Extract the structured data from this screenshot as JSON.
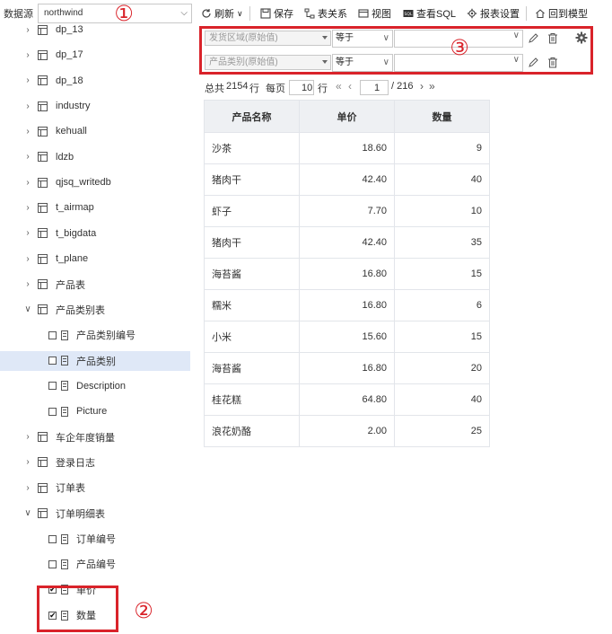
{
  "datasource": {
    "label": "数据源",
    "value": "northwind"
  },
  "tree": [
    {
      "level": 0,
      "kind": "table",
      "expanded": false,
      "label": "dp_13"
    },
    {
      "level": 0,
      "kind": "table",
      "expanded": false,
      "label": "dp_17"
    },
    {
      "level": 0,
      "kind": "table",
      "expanded": false,
      "label": "dp_18"
    },
    {
      "level": 0,
      "kind": "table",
      "expanded": false,
      "label": "industry"
    },
    {
      "level": 0,
      "kind": "table",
      "expanded": false,
      "label": "kehuall"
    },
    {
      "level": 0,
      "kind": "table",
      "expanded": false,
      "label": "ldzb"
    },
    {
      "level": 0,
      "kind": "table",
      "expanded": false,
      "label": "qjsq_writedb"
    },
    {
      "level": 0,
      "kind": "table",
      "expanded": false,
      "label": "t_airmap"
    },
    {
      "level": 0,
      "kind": "table",
      "expanded": false,
      "label": "t_bigdata"
    },
    {
      "level": 0,
      "kind": "table",
      "expanded": false,
      "label": "t_plane"
    },
    {
      "level": 0,
      "kind": "table",
      "expanded": false,
      "label": "产品表"
    },
    {
      "level": 0,
      "kind": "table",
      "expanded": true,
      "label": "产品类别表"
    },
    {
      "level": 1,
      "kind": "field",
      "checked": false,
      "label": "产品类别编号"
    },
    {
      "level": 1,
      "kind": "field",
      "checked": false,
      "label": "产品类别",
      "selected": true
    },
    {
      "level": 1,
      "kind": "field",
      "checked": false,
      "label": "Description"
    },
    {
      "level": 1,
      "kind": "field",
      "checked": false,
      "label": "Picture"
    },
    {
      "level": 0,
      "kind": "table",
      "expanded": false,
      "label": "车企年度销量"
    },
    {
      "level": 0,
      "kind": "table",
      "expanded": false,
      "label": "登录日志"
    },
    {
      "level": 0,
      "kind": "table",
      "expanded": false,
      "label": "订单表"
    },
    {
      "level": 0,
      "kind": "table",
      "expanded": true,
      "label": "订单明细表"
    },
    {
      "level": 1,
      "kind": "field",
      "checked": false,
      "label": "订单编号"
    },
    {
      "level": 1,
      "kind": "field",
      "checked": false,
      "label": "产品编号"
    },
    {
      "level": 1,
      "kind": "field",
      "checked": true,
      "label": "单价"
    },
    {
      "level": 1,
      "kind": "field",
      "checked": true,
      "label": "数量"
    }
  ],
  "toolbar": {
    "refresh": "刷新",
    "save": "保存",
    "relations": "表关系",
    "view": "视图",
    "sql": "查看SQL",
    "report_settings": "报表设置",
    "back_to_model": "回到模型"
  },
  "filters": [
    {
      "field_placeholder": "发货区域(原始值)",
      "operator": "等于",
      "value": ""
    },
    {
      "field_placeholder": "产品类别(原始值)",
      "operator": "等于",
      "value": ""
    }
  ],
  "pager": {
    "total_prefix": "总共",
    "total": "2154",
    "total_suffix": "行",
    "per_page_prefix": "每页",
    "per_page": "10",
    "per_page_suffix": "行",
    "current_page": "1",
    "total_pages": "/ 216"
  },
  "grid": {
    "columns": [
      "产品名称",
      "单价",
      "数量"
    ],
    "rows": [
      [
        "沙茶",
        "18.60",
        "9"
      ],
      [
        "猪肉干",
        "42.40",
        "40"
      ],
      [
        "虾子",
        "7.70",
        "10"
      ],
      [
        "猪肉干",
        "42.40",
        "35"
      ],
      [
        "海苔酱",
        "16.80",
        "15"
      ],
      [
        "糯米",
        "16.80",
        "6"
      ],
      [
        "小米",
        "15.60",
        "15"
      ],
      [
        "海苔酱",
        "16.80",
        "20"
      ],
      [
        "桂花糕",
        "64.80",
        "40"
      ],
      [
        "浪花奶酪",
        "2.00",
        "25"
      ]
    ]
  },
  "annotations": {
    "one": "①",
    "two": "②",
    "three": "③"
  },
  "colors": {
    "accent_red": "#d9232a",
    "selected_row": "#dfe8f7",
    "grid_header": "#eef0f3"
  }
}
